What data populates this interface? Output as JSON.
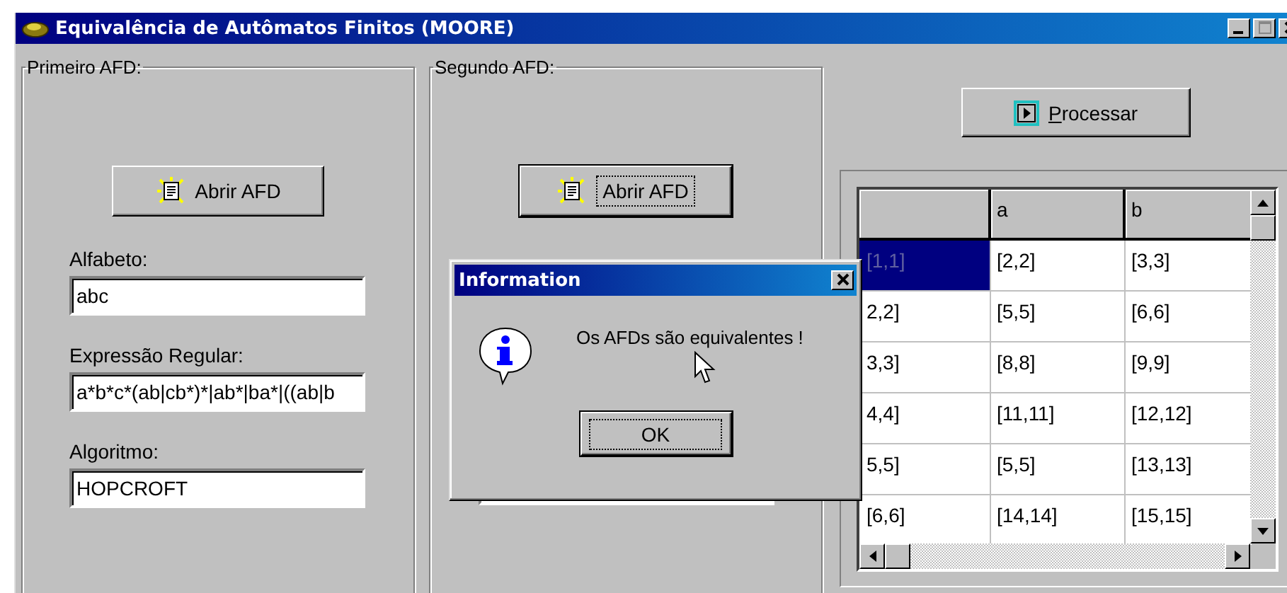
{
  "window": {
    "title": "Equivalência de Autômatos Finitos (MOORE)"
  },
  "first_afd": {
    "title": "Primeiro AFD:",
    "open_button": "Abrir AFD",
    "fields": [
      {
        "label": "Alfabeto:",
        "value": "abc"
      },
      {
        "label": "Expressão Regular:",
        "value": "a*b*c*(ab|cb*)*|ab*|ba*|((ab|b"
      },
      {
        "label": "Algoritmo:",
        "value": "HOPCROFT"
      }
    ]
  },
  "second_afd": {
    "title": "Segundo AFD:",
    "open_button": "Abrir AFD"
  },
  "process_button": "Processar",
  "table": {
    "columns": [
      "",
      "a",
      "b"
    ],
    "rows": [
      {
        "cells": [
          "[1,1]",
          "[2,2]",
          "[3,3]"
        ],
        "selected": true
      },
      {
        "cells": [
          "2,2]",
          "[5,5]",
          "[6,6]"
        ],
        "selected": false
      },
      {
        "cells": [
          "3,3]",
          "[8,8]",
          "[9,9]"
        ],
        "selected": false
      },
      {
        "cells": [
          "4,4]",
          "[11,11]",
          "[12,12]"
        ],
        "selected": false
      },
      {
        "cells": [
          "5,5]",
          "[5,5]",
          "[13,13]"
        ],
        "selected": false
      },
      {
        "cells": [
          "[6,6]",
          "[14,14]",
          "[15,15]"
        ],
        "selected": false
      }
    ]
  },
  "dialog": {
    "title": "Information",
    "message": "Os AFDs são equivalentes !",
    "button": "OK"
  }
}
